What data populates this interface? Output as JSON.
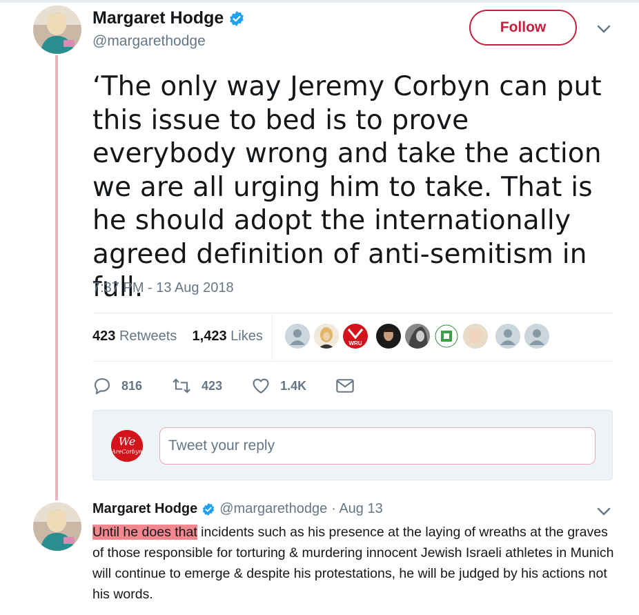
{
  "main_tweet": {
    "name": "Margaret Hodge",
    "handle": "@margarethodge",
    "follow_label": "Follow",
    "text": "‘The only way Jeremy Corbyn can put this issue to bed is to prove everybody wrong and take the action we are all urging him to take. That is he should adopt the internationally agreed definition of anti-semitism in full.",
    "timestamp": "7:37 PM - 13 Aug 2018",
    "retweets_count": "423",
    "retweets_label": "Retweets",
    "likes_count": "1,423",
    "likes_label": "Likes"
  },
  "actions": {
    "replies": "816",
    "retweets": "423",
    "likes": "1.4K"
  },
  "reply_box": {
    "placeholder": "Tweet your reply",
    "avatar_text_top": "We",
    "avatar_text_bottom": "AreCorbyn"
  },
  "reply_tweet": {
    "name": "Margaret Hodge",
    "handle": "@margarethodge",
    "date": "· Aug 13",
    "highlighted": "Until he does that",
    "text_rest": " incidents such as his presence at the laying of wreaths at the graves of those responsible for torturing & murdering innocent Jewish Israeli athletes in Munich will continue to emerge & despite his protestations, he will be judged by his actions not his words."
  },
  "colors": {
    "accent": "#c81d3c",
    "verified": "#1da1f2",
    "thread_line": "#e8b4bd",
    "highlight": "#f2888f"
  }
}
